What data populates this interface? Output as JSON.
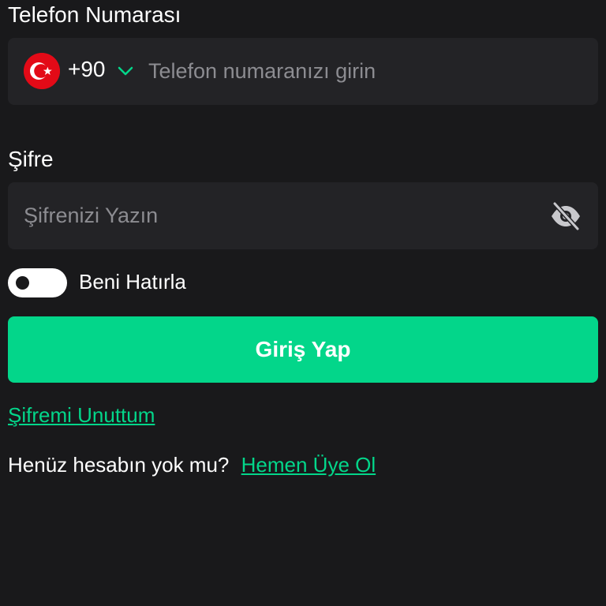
{
  "phone": {
    "label": "Telefon Numarası",
    "country_flag": "turkey-flag-icon",
    "country_code": "+90",
    "placeholder": "Telefon numaranızı girin",
    "value": ""
  },
  "password": {
    "label": "Şifre",
    "placeholder": "Şifrenizi Yazın",
    "value": "",
    "visibility_icon": "eye-slash-icon"
  },
  "remember": {
    "label": "Beni Hatırla",
    "checked": false
  },
  "login_button": {
    "label": "Giriş Yap"
  },
  "forgot_link": {
    "label": "Şifremi Unuttum"
  },
  "signup": {
    "prompt": "Henüz hesabın yok mu?",
    "link_label": "Hemen Üye Ol"
  },
  "colors": {
    "background": "#19191b",
    "field_background": "#232326",
    "accent": "#03d68a",
    "placeholder": "#8c8c91"
  }
}
